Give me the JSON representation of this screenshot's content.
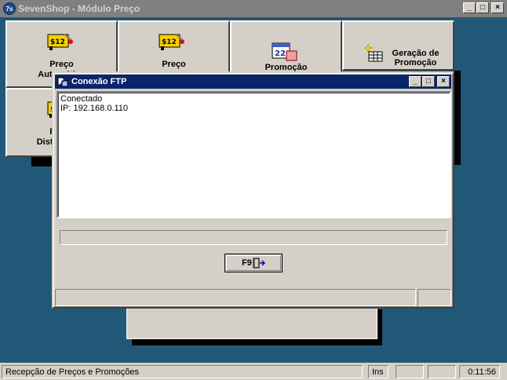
{
  "window": {
    "title": "SevenShop - Módulo Preço",
    "icon_text": "7s"
  },
  "caption_buttons": {
    "minimize": "_",
    "maximize": "□",
    "close": "×"
  },
  "menu": {
    "btn1": {
      "line1": "Preço",
      "line2": "Automático"
    },
    "btn2": {
      "line1": "Preço"
    },
    "btn3": {
      "line1": "Promoção",
      "calendar_number": "22"
    },
    "btn4": {
      "line1": "Geração de",
      "line2": "Promoção"
    },
    "btn5": {
      "line1": "Preço",
      "line2": "Distribuição"
    },
    "tag_text": "$12"
  },
  "dialog": {
    "title": "Conexão FTP",
    "log": [
      "Conectado",
      "IP: 192.168.0.110"
    ],
    "f9_label": "F9"
  },
  "statusbar": {
    "message": "Recepção de Preços e Promoções",
    "mode": "Ins",
    "time": "0:11:56"
  },
  "colors": {
    "desktop": "#215878",
    "dialog_title": "#0a246a",
    "face": "#d4d0c8"
  }
}
